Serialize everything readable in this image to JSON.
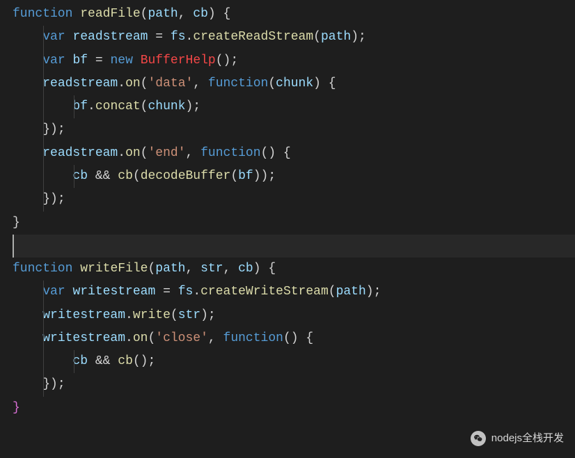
{
  "code": {
    "lines": [
      {
        "indent": 0,
        "guides": [],
        "tokens": [
          {
            "cls": "kw",
            "t": "function"
          },
          {
            "cls": "pn",
            "t": " "
          },
          {
            "cls": "fn",
            "t": "readFile"
          },
          {
            "cls": "pn",
            "t": "("
          },
          {
            "cls": "id",
            "t": "path"
          },
          {
            "cls": "pn",
            "t": ", "
          },
          {
            "cls": "id",
            "t": "cb"
          },
          {
            "cls": "pn",
            "t": ") {"
          }
        ]
      },
      {
        "indent": 1,
        "guides": [
          1
        ],
        "tokens": [
          {
            "cls": "kw",
            "t": "var"
          },
          {
            "cls": "pn",
            "t": " "
          },
          {
            "cls": "id",
            "t": "readstream"
          },
          {
            "cls": "pn",
            "t": " "
          },
          {
            "cls": "op",
            "t": "="
          },
          {
            "cls": "pn",
            "t": " "
          },
          {
            "cls": "id",
            "t": "fs"
          },
          {
            "cls": "pn",
            "t": "."
          },
          {
            "cls": "fn",
            "t": "createReadStream"
          },
          {
            "cls": "pn",
            "t": "("
          },
          {
            "cls": "id",
            "t": "path"
          },
          {
            "cls": "pn",
            "t": ");"
          }
        ]
      },
      {
        "indent": 1,
        "guides": [
          1
        ],
        "tokens": [
          {
            "cls": "kw",
            "t": "var"
          },
          {
            "cls": "pn",
            "t": " "
          },
          {
            "cls": "id",
            "t": "bf"
          },
          {
            "cls": "pn",
            "t": " "
          },
          {
            "cls": "op",
            "t": "="
          },
          {
            "cls": "pn",
            "t": " "
          },
          {
            "cls": "kw",
            "t": "new"
          },
          {
            "cls": "pn",
            "t": " "
          },
          {
            "cls": "err",
            "t": "BufferHelp"
          },
          {
            "cls": "pn",
            "t": "();"
          }
        ]
      },
      {
        "indent": 1,
        "guides": [
          1
        ],
        "tokens": [
          {
            "cls": "id",
            "t": "readstream"
          },
          {
            "cls": "pn",
            "t": "."
          },
          {
            "cls": "fn",
            "t": "on"
          },
          {
            "cls": "pn",
            "t": "("
          },
          {
            "cls": "str",
            "t": "'data'"
          },
          {
            "cls": "pn",
            "t": ", "
          },
          {
            "cls": "kw",
            "t": "function"
          },
          {
            "cls": "pn",
            "t": "("
          },
          {
            "cls": "id",
            "t": "chunk"
          },
          {
            "cls": "pn",
            "t": ") {"
          }
        ]
      },
      {
        "indent": 2,
        "guides": [
          1,
          2
        ],
        "tokens": [
          {
            "cls": "id",
            "t": "bf"
          },
          {
            "cls": "pn",
            "t": "."
          },
          {
            "cls": "fn",
            "t": "concat"
          },
          {
            "cls": "pn",
            "t": "("
          },
          {
            "cls": "id",
            "t": "chunk"
          },
          {
            "cls": "pn",
            "t": ");"
          }
        ]
      },
      {
        "indent": 1,
        "guides": [
          1
        ],
        "tokens": [
          {
            "cls": "pn",
            "t": "});"
          }
        ]
      },
      {
        "indent": 1,
        "guides": [
          1
        ],
        "tokens": [
          {
            "cls": "id",
            "t": "readstream"
          },
          {
            "cls": "pn",
            "t": "."
          },
          {
            "cls": "fn",
            "t": "on"
          },
          {
            "cls": "pn",
            "t": "("
          },
          {
            "cls": "str",
            "t": "'end'"
          },
          {
            "cls": "pn",
            "t": ", "
          },
          {
            "cls": "kw",
            "t": "function"
          },
          {
            "cls": "pn",
            "t": "() {"
          }
        ]
      },
      {
        "indent": 2,
        "guides": [
          1,
          2
        ],
        "tokens": [
          {
            "cls": "id",
            "t": "cb"
          },
          {
            "cls": "pn",
            "t": " "
          },
          {
            "cls": "op",
            "t": "&&"
          },
          {
            "cls": "pn",
            "t": " "
          },
          {
            "cls": "fn",
            "t": "cb"
          },
          {
            "cls": "pn",
            "t": "("
          },
          {
            "cls": "fn",
            "t": "decodeBuffer"
          },
          {
            "cls": "pn",
            "t": "("
          },
          {
            "cls": "id",
            "t": "bf"
          },
          {
            "cls": "pn",
            "t": "));"
          }
        ]
      },
      {
        "indent": 1,
        "guides": [
          1
        ],
        "tokens": [
          {
            "cls": "pn",
            "t": "});"
          }
        ]
      },
      {
        "indent": 0,
        "guides": [],
        "tokens": [
          {
            "cls": "pn",
            "t": "}"
          }
        ]
      },
      {
        "blank": true
      },
      {
        "indent": 0,
        "guides": [],
        "tokens": [
          {
            "cls": "kw",
            "t": "function"
          },
          {
            "cls": "pn",
            "t": " "
          },
          {
            "cls": "fn",
            "t": "writeFile"
          },
          {
            "cls": "pn",
            "t": "("
          },
          {
            "cls": "id",
            "t": "path"
          },
          {
            "cls": "pn",
            "t": ", "
          },
          {
            "cls": "id",
            "t": "str"
          },
          {
            "cls": "pn",
            "t": ", "
          },
          {
            "cls": "id",
            "t": "cb"
          },
          {
            "cls": "pn",
            "t": ") {"
          }
        ]
      },
      {
        "indent": 1,
        "guides": [
          1
        ],
        "tokens": [
          {
            "cls": "kw",
            "t": "var"
          },
          {
            "cls": "pn",
            "t": " "
          },
          {
            "cls": "id",
            "t": "writestream"
          },
          {
            "cls": "pn",
            "t": " "
          },
          {
            "cls": "op",
            "t": "="
          },
          {
            "cls": "pn",
            "t": " "
          },
          {
            "cls": "id",
            "t": "fs"
          },
          {
            "cls": "pn",
            "t": "."
          },
          {
            "cls": "fn",
            "t": "createWriteStream"
          },
          {
            "cls": "pn",
            "t": "("
          },
          {
            "cls": "id",
            "t": "path"
          },
          {
            "cls": "pn",
            "t": ");"
          }
        ]
      },
      {
        "indent": 0,
        "guides": [
          1
        ],
        "tokens": [
          {
            "cls": "pn",
            "t": ""
          }
        ]
      },
      {
        "indent": 1,
        "guides": [
          1
        ],
        "tokens": [
          {
            "cls": "id",
            "t": "writestream"
          },
          {
            "cls": "pn",
            "t": "."
          },
          {
            "cls": "fn",
            "t": "write"
          },
          {
            "cls": "pn",
            "t": "("
          },
          {
            "cls": "id",
            "t": "str"
          },
          {
            "cls": "pn",
            "t": ");"
          }
        ]
      },
      {
        "indent": 1,
        "guides": [
          1
        ],
        "tokens": [
          {
            "cls": "id",
            "t": "writestream"
          },
          {
            "cls": "pn",
            "t": "."
          },
          {
            "cls": "fn",
            "t": "on"
          },
          {
            "cls": "pn",
            "t": "("
          },
          {
            "cls": "str",
            "t": "'close'"
          },
          {
            "cls": "pn",
            "t": ", "
          },
          {
            "cls": "kw",
            "t": "function"
          },
          {
            "cls": "pn",
            "t": "() {"
          }
        ]
      },
      {
        "indent": 2,
        "guides": [
          1,
          2
        ],
        "tokens": [
          {
            "cls": "id",
            "t": "cb"
          },
          {
            "cls": "pn",
            "t": " "
          },
          {
            "cls": "op",
            "t": "&&"
          },
          {
            "cls": "pn",
            "t": " "
          },
          {
            "cls": "fn",
            "t": "cb"
          },
          {
            "cls": "pn",
            "t": "();"
          }
        ]
      },
      {
        "indent": 1,
        "guides": [
          1
        ],
        "tokens": [
          {
            "cls": "pn",
            "t": "});"
          }
        ]
      },
      {
        "indent": 0,
        "guides": [],
        "tokens": [
          {
            "cls": "brk",
            "t": "}"
          }
        ]
      }
    ]
  },
  "watermark": {
    "text": "nodejs全栈开发"
  }
}
